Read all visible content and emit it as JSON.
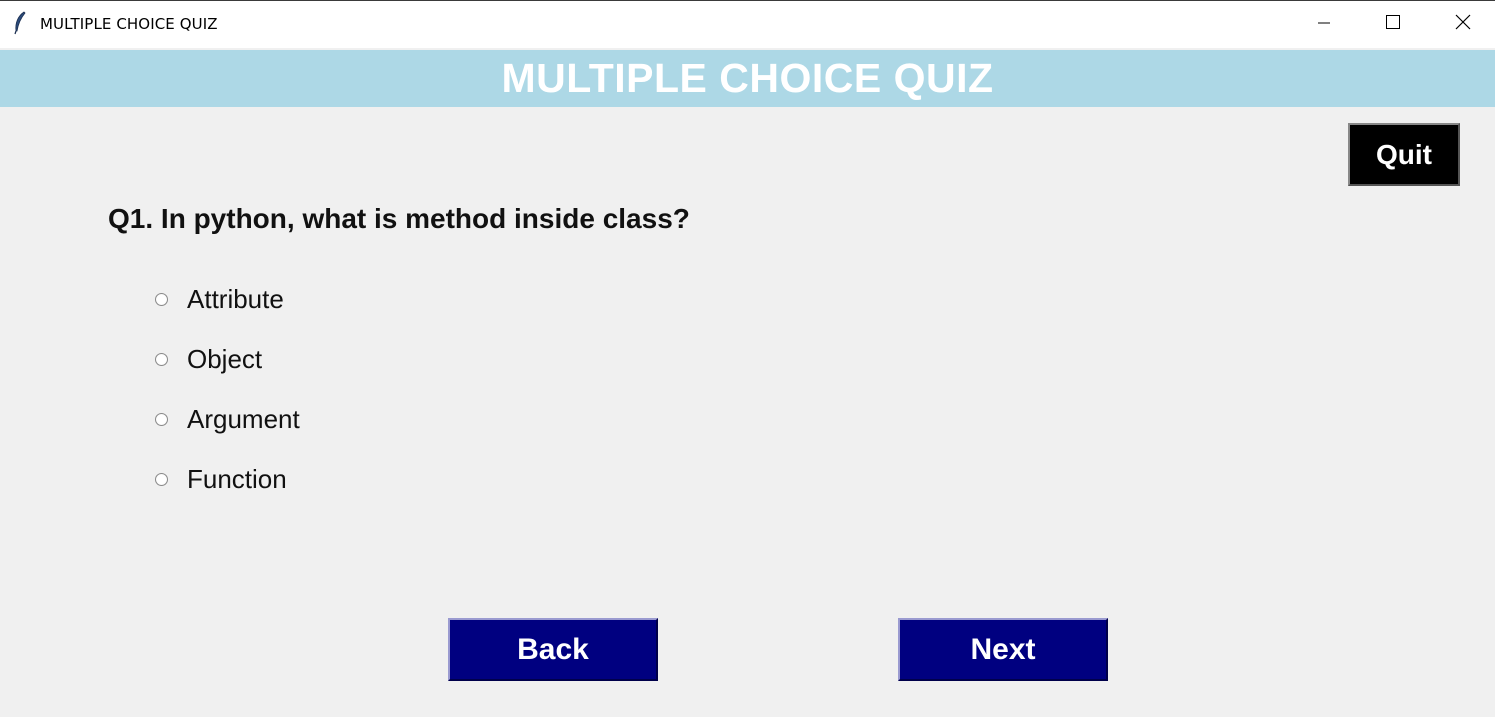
{
  "window": {
    "title": "MULTIPLE CHOICE QUIZ",
    "controls": [
      "minimize-icon",
      "maximize-icon",
      "close-icon"
    ]
  },
  "banner": {
    "title": "MULTIPLE CHOICE QUIZ",
    "background": "#add8e6",
    "text_color": "#ffffff"
  },
  "quit_button": {
    "label": "Quit",
    "background": "#000000"
  },
  "question": {
    "text": "Q1. In python, what is method inside class?"
  },
  "options": [
    {
      "label": "Attribute",
      "selected": false
    },
    {
      "label": "Object",
      "selected": false
    },
    {
      "label": "Argument",
      "selected": false
    },
    {
      "label": "Function",
      "selected": false
    }
  ],
  "navigation": {
    "back_label": "Back",
    "next_label": "Next",
    "background": "#000080"
  }
}
